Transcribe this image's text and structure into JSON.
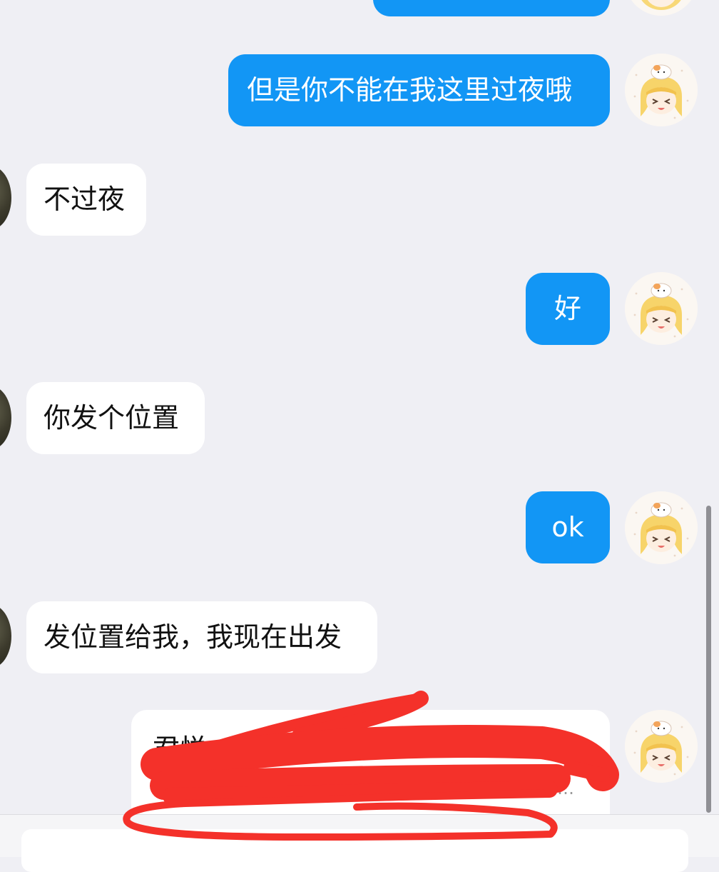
{
  "messages": [
    {
      "side": "out",
      "text": ""
    },
    {
      "side": "out",
      "text": "但是你不能在我这里过夜哦"
    },
    {
      "side": "in",
      "text": "不过夜"
    },
    {
      "side": "out",
      "text": "好"
    },
    {
      "side": "in",
      "text": "你发个位置"
    },
    {
      "side": "out",
      "text": "ok"
    },
    {
      "side": "in",
      "text": "发位置给我，我现在出发"
    }
  ],
  "location_card": {
    "title": "君悦",
    "title_tail": "…",
    "subtitle": "…",
    "redacted": true
  },
  "input": {
    "placeholder": ""
  },
  "colors": {
    "outgoing_bubble": "#1296f5",
    "incoming_bubble": "#ffffff",
    "background": "#efeff4",
    "redaction": "#f4312a"
  },
  "icons": {
    "self_avatar": "anime-girl-with-cat-avatar",
    "peer_avatar": "photo-avatar"
  }
}
